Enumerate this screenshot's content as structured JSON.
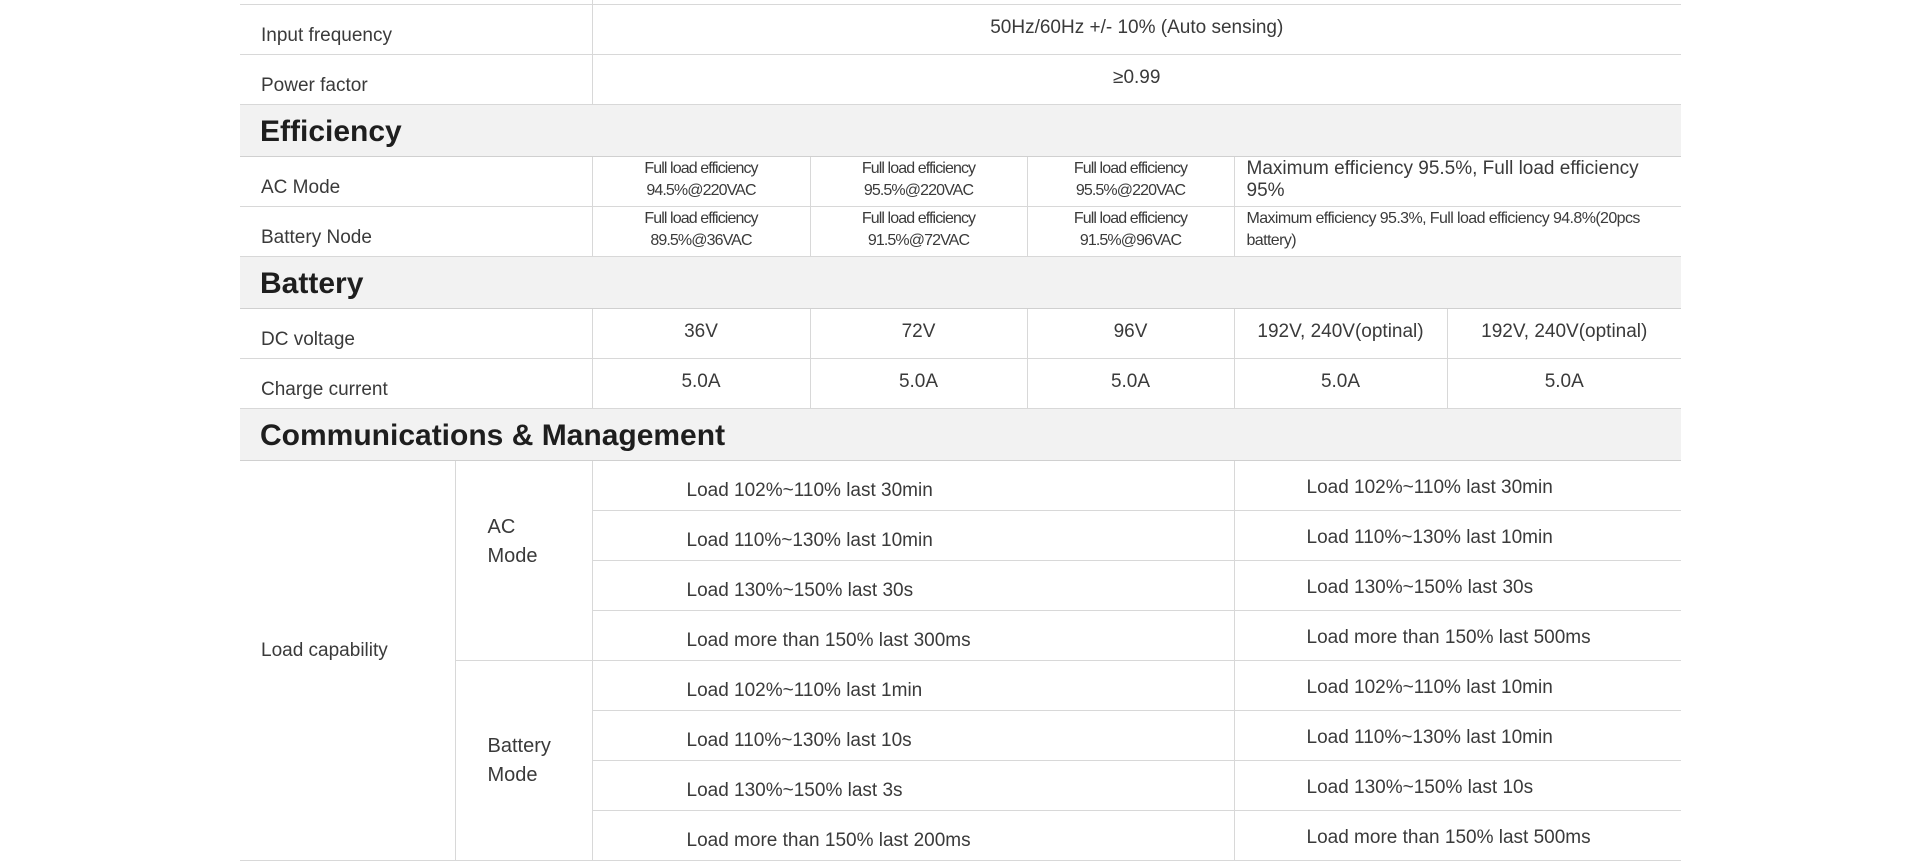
{
  "rows_top": [
    {
      "label": "Input frequency",
      "value": "50Hz/60Hz +/- 10% (Auto sensing)"
    },
    {
      "label": "Power factor",
      "value": "≥0.99"
    }
  ],
  "efficiency": {
    "title": "Efficiency",
    "ac_mode": {
      "label": "AC Mode",
      "values": [
        "Full load efficiency 94.5%@220VAC",
        "Full load efficiency 95.5%@220VAC",
        "Full load efficiency 95.5%@220VAC",
        "Maximum efficiency 95.5%, Full load efficiency 95%"
      ]
    },
    "battery_node": {
      "label": "Battery Node",
      "values": [
        "Full load efficiency 89.5%@36VAC",
        "Full load efficiency 91.5%@72VAC",
        "Full load efficiency 91.5%@96VAC",
        "Maximum efficiency 95.3%, Full load efficiency 94.8%(20pcs battery)"
      ]
    }
  },
  "battery": {
    "title": "Battery",
    "dc_voltage": {
      "label": "DC voltage",
      "values": [
        "36V",
        "72V",
        "96V",
        "192V, 240V(optinal)",
        "192V, 240V(optinal)"
      ]
    },
    "charge_current": {
      "label": "Charge current",
      "values": [
        "5.0A",
        "5.0A",
        "5.0A",
        "5.0A",
        "5.0A"
      ]
    }
  },
  "communications": {
    "title": "Communications & Management",
    "load_capability": {
      "label": "Load capability",
      "ac_mode": {
        "label_line1": "AC",
        "label_line2": "Mode",
        "rows": [
          {
            "left": "Load 102%~110% last 30min",
            "right": "Load 102%~110% last 30min"
          },
          {
            "left": "Load 110%~130% last 10min",
            "right": "Load 110%~130% last 10min"
          },
          {
            "left": "Load 130%~150% last 30s",
            "right": "Load 130%~150% last 30s"
          },
          {
            "left": "Load more than 150% last 300ms",
            "right": "Load more than 150% last 500ms"
          }
        ]
      },
      "battery_mode": {
        "label_line1": "Battery",
        "label_line2": "Mode",
        "rows": [
          {
            "left": "Load 102%~110% last 1min",
            "right": "Load 102%~110% last 10min"
          },
          {
            "left": "Load 110%~130% last 10s",
            "right": "Load 110%~130% last 10min"
          },
          {
            "left": "Load 130%~150% last 3s",
            "right": "Load 130%~150% last 10s"
          },
          {
            "left": "Load more than 150% last 200ms",
            "right": "Load more than 150% last 500ms"
          }
        ]
      }
    }
  }
}
